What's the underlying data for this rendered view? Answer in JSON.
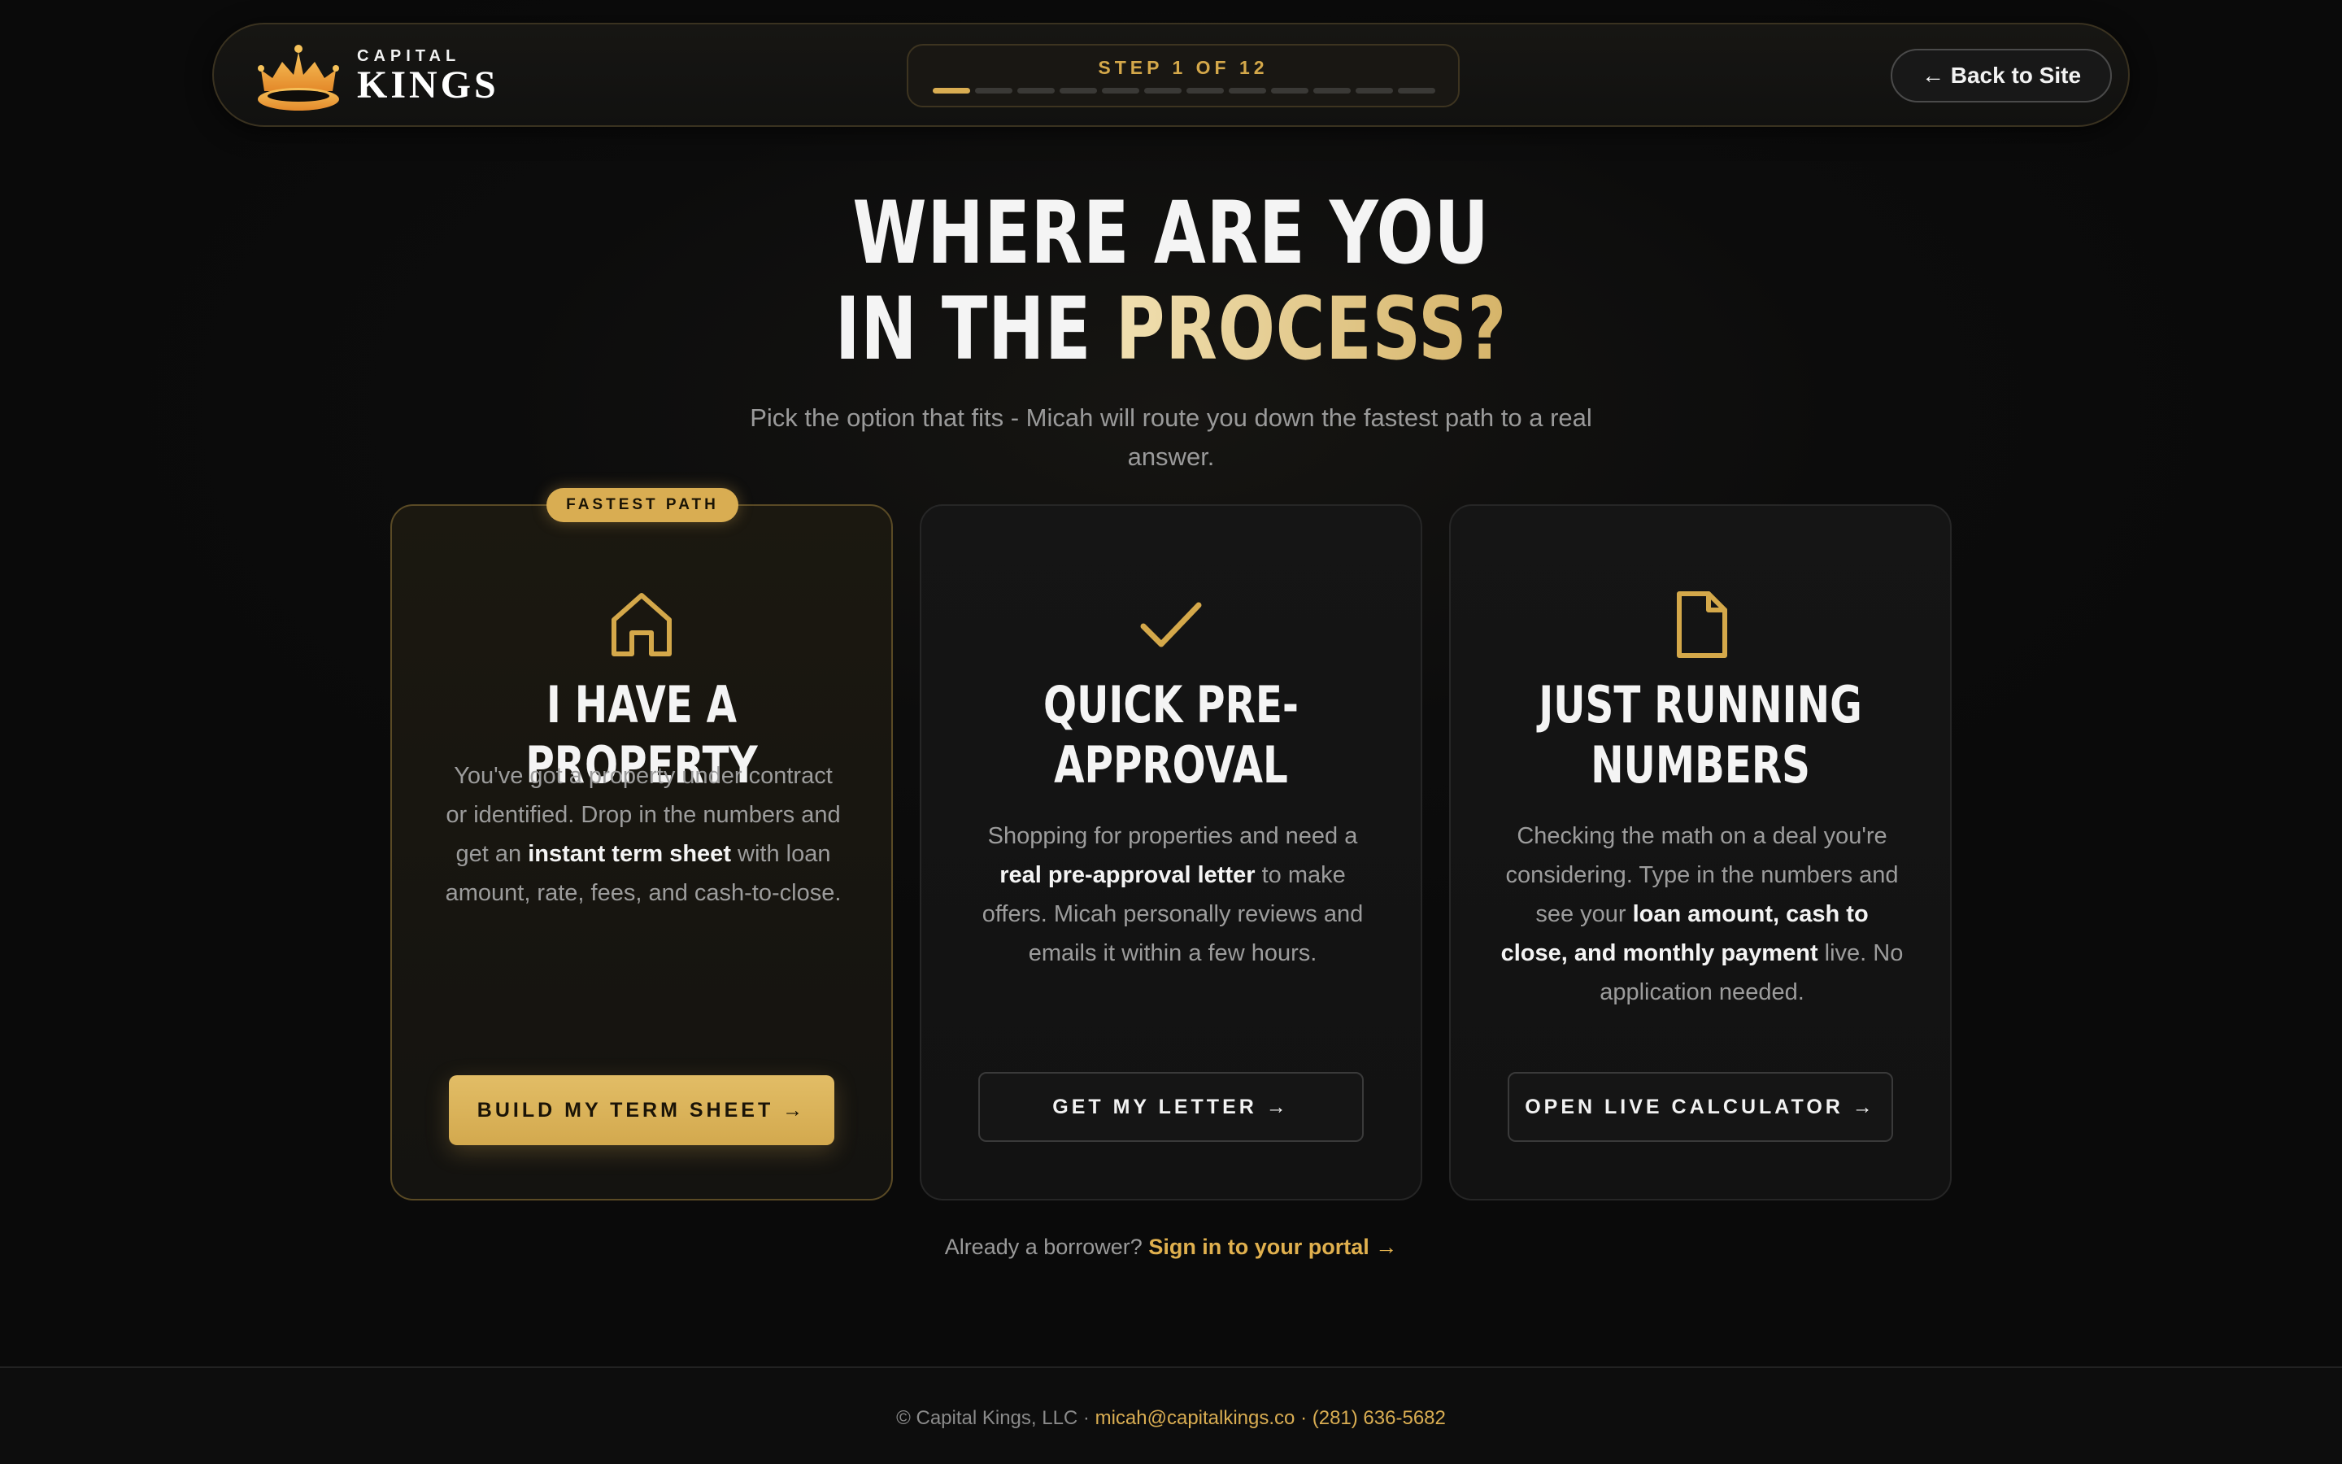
{
  "header": {
    "logo_small": "CAPITAL",
    "logo_big": "KINGS",
    "step_label": "STEP 1 OF 12",
    "step_total": 12,
    "step_current": 1,
    "back_label": "← Back to Site"
  },
  "hero": {
    "title_line1": "WHERE ARE YOU",
    "title_line2_plain": "IN THE ",
    "title_line2_gold": "PROCESS?",
    "subtitle": "Pick the option that fits - Micah will route you down the fastest path to a real answer."
  },
  "cards": [
    {
      "badge": "FASTEST PATH",
      "icon": "home-icon",
      "title": "I HAVE A PROPERTY",
      "desc_1": "You've got a property under contract or identified. Drop in the numbers and get an ",
      "desc_bold_1": "instant term sheet",
      "desc_2": " with loan amount, rate, fees, and cash-to-close.",
      "button": "BUILD MY TERM SHEET →"
    },
    {
      "icon": "check-icon",
      "title_line1": "QUICK PRE-",
      "title_line2": "APPROVAL",
      "desc_1": "Shopping for properties and need a ",
      "desc_bold_1": "real pre-approval letter",
      "desc_2": " to make offers. Micah personally reviews and emails it within a few hours.",
      "button": "GET MY LETTER →"
    },
    {
      "icon": "document-icon",
      "title_line1": "JUST RUNNING",
      "title_line2": "NUMBERS",
      "desc_1": "Checking the math on a deal you're considering. Type in the numbers and see your ",
      "desc_bold_1": "loan amount, cash to close, and monthly payment",
      "desc_2": " live. No application needed.",
      "button": "OPEN LIVE CALCULATOR →"
    }
  ],
  "signin": {
    "prefix": "Already a borrower? ",
    "link": "Sign in to your portal →"
  },
  "footer": {
    "company": "© Capital Kings, LLC · ",
    "email": "micah@capitalkings.co",
    "sep": " · ",
    "phone": "(281) 636-5682"
  },
  "colors": {
    "accent": "#d9ad52",
    "background": "#0b0b0b"
  }
}
